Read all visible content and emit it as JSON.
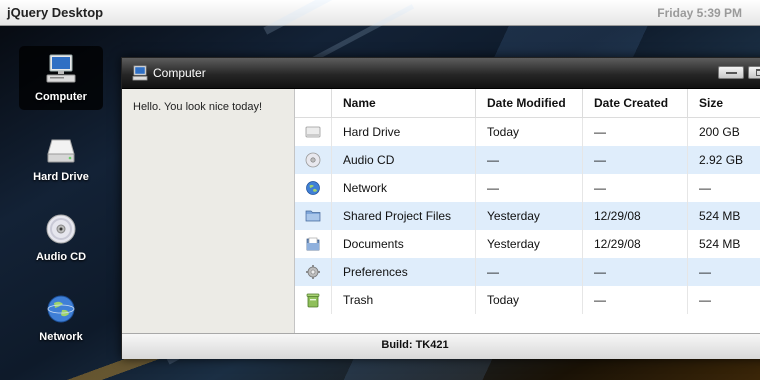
{
  "topbar": {
    "title": "jQuery Desktop",
    "clock": "Friday 5:39 PM"
  },
  "desktop_icons": [
    {
      "label": "Computer",
      "icon": "computer-icon",
      "active": true
    },
    {
      "label": "Hard Drive",
      "icon": "hard-drive-icon",
      "active": false
    },
    {
      "label": "Audio CD",
      "icon": "audio-cd-icon",
      "active": false
    },
    {
      "label": "Network",
      "icon": "network-icon",
      "active": false
    }
  ],
  "window": {
    "title": "Computer",
    "icon": "computer-icon",
    "sidebar_message": "Hello. You look nice today!",
    "footer": "Build: TK421",
    "columns": [
      "Name",
      "Date Modified",
      "Date Created",
      "Size"
    ],
    "rows": [
      {
        "icon": "hard-drive-icon",
        "name": "Hard Drive",
        "modified": "Today",
        "created": "—",
        "size": "200 GB"
      },
      {
        "icon": "audio-cd-icon",
        "name": "Audio CD",
        "modified": "—",
        "created": "—",
        "size": "2.92 GB"
      },
      {
        "icon": "network-icon",
        "name": "Network",
        "modified": "—",
        "created": "—",
        "size": "—"
      },
      {
        "icon": "folder-icon",
        "name": "Shared Project Files",
        "modified": "Yesterday",
        "created": "12/29/08",
        "size": "524 MB"
      },
      {
        "icon": "documents-icon",
        "name": "Documents",
        "modified": "Yesterday",
        "created": "12/29/08",
        "size": "524 MB"
      },
      {
        "icon": "preferences-icon",
        "name": "Preferences",
        "modified": "—",
        "created": "—",
        "size": "—"
      },
      {
        "icon": "trash-icon",
        "name": "Trash",
        "modified": "Today",
        "created": "—",
        "size": "—"
      }
    ]
  },
  "colors": {
    "row_alt": "#dfedfb",
    "window_header": "#262626",
    "clock": "#9a9a9a"
  }
}
